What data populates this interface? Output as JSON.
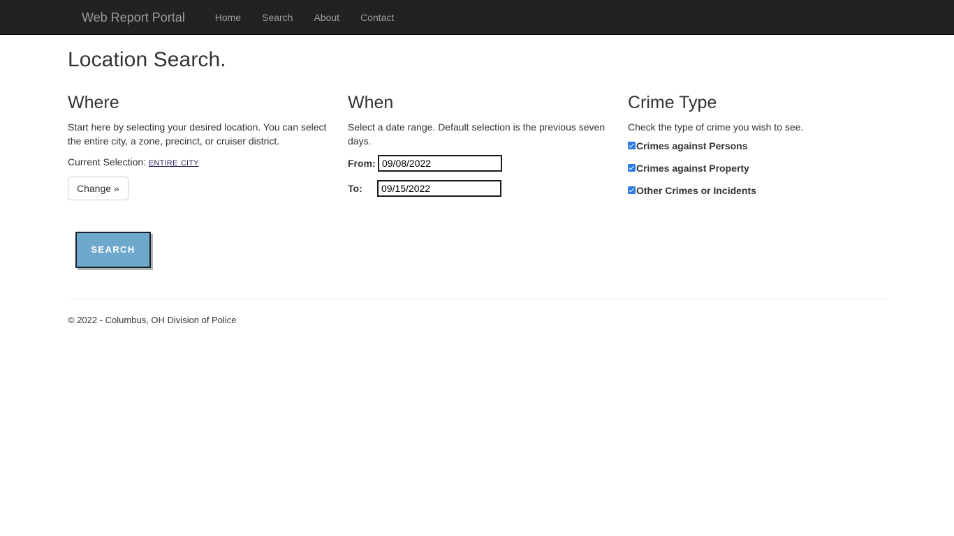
{
  "navbar": {
    "brand": "Web Report Portal",
    "links": [
      {
        "label": "Home"
      },
      {
        "label": "Search"
      },
      {
        "label": "About"
      },
      {
        "label": "Contact"
      }
    ]
  },
  "page": {
    "title": "Location Search."
  },
  "where": {
    "heading": "Where",
    "description": "Start here by selecting your desired location. You can select the entire city, a zone, precinct, or cruiser district.",
    "selection_label": "Current Selection:",
    "selection_value": "Entire City",
    "change_button": "Change »"
  },
  "when": {
    "heading": "When",
    "description": "Select a date range. Default selection is the previous seven days.",
    "from_label": "From:",
    "from_value": "09/08/2022",
    "to_label": "To:",
    "to_value": "09/15/2022"
  },
  "crime_type": {
    "heading": "Crime Type",
    "description": "Check the type of crime you wish to see.",
    "options": [
      {
        "label": "Crimes against Persons",
        "checked": true
      },
      {
        "label": "Crimes against Property",
        "checked": true
      },
      {
        "label": "Other Crimes or Incidents",
        "checked": true
      }
    ]
  },
  "actions": {
    "search_button": "Search"
  },
  "footer": {
    "copyright": "© 2022 - Columbus, OH Division of Police"
  },
  "colors": {
    "navbar_bg": "#222222",
    "nav_link": "#9d9d9d",
    "heading": "#333333",
    "checkbox_blue": "#2a7ae2",
    "search_button_bg": "#6fa8cd",
    "search_button_border": "#16222b",
    "link_visited": "#2b1f5c"
  }
}
